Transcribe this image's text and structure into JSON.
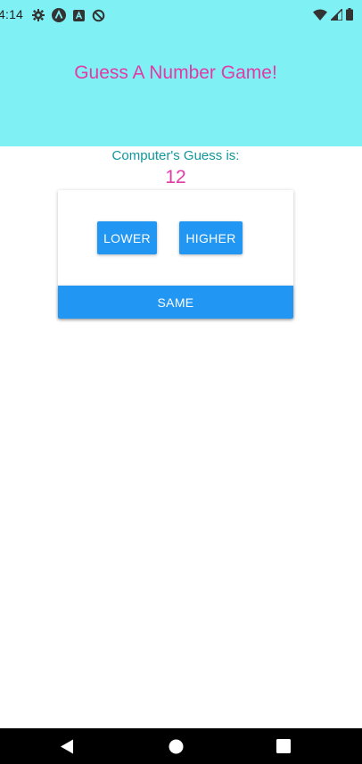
{
  "status_bar": {
    "time": "4:14",
    "left_icons": [
      "gear-icon",
      "app-a-icon",
      "text-a-icon",
      "no-sync-icon"
    ],
    "right_icons": [
      "wifi-icon",
      "signal-icon",
      "battery-icon"
    ]
  },
  "header": {
    "title": "Guess A Number Game!"
  },
  "guess": {
    "label": "Computer's Guess is:",
    "value": "12"
  },
  "buttons": {
    "lower": "LOWER",
    "higher": "HIGHER",
    "same": "SAME"
  },
  "nav_bar": {
    "icons": [
      "back-icon",
      "home-icon",
      "recents-icon"
    ]
  },
  "colors": {
    "header_bg": "#7ff0f3",
    "accent_pink": "#e23aa6",
    "label_teal": "#12969c",
    "button_blue": "#2196f3"
  }
}
